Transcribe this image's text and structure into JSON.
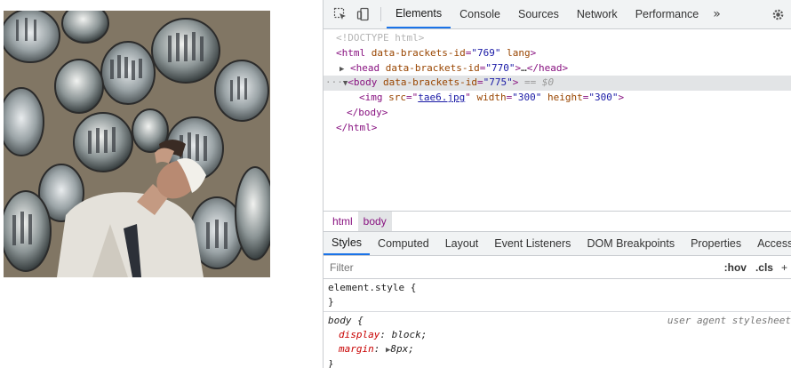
{
  "page": {
    "image_alt": "Photo of a young man in a white jacket and cap looking upward, surrounded by round convex mirrors reflecting a group of people in an alley"
  },
  "devtools": {
    "tabs": [
      "Elements",
      "Console",
      "Sources",
      "Network",
      "Performance"
    ],
    "more_tabs": "»",
    "dom": {
      "doctype": "<!DOCTYPE html>",
      "html_open_tag": "html",
      "html_attr": "data-brackets-id",
      "html_attr_val": "\"769\"",
      "html_attr2": "lang",
      "head_tag": "head",
      "head_attr": "data-brackets-id",
      "head_attr_val": "\"770\"",
      "head_ellipsis": "…",
      "head_close": "</head>",
      "body_tag": "body",
      "body_attr": "data-brackets-id",
      "body_attr_val": "\"775\"",
      "body_eq": "== $0",
      "img_tag": "img",
      "img_src_attr": "src",
      "img_src_val": "tae6.jpg",
      "img_width_attr": "width",
      "img_width_val": "\"300\"",
      "img_height_attr": "height",
      "img_height_val": "\"300\"",
      "body_close": "</body>",
      "html_close": "</html>"
    },
    "breadcrumbs": [
      "html",
      "body"
    ],
    "sub_tabs": [
      "Styles",
      "Computed",
      "Layout",
      "Event Listeners",
      "DOM Breakpoints",
      "Properties",
      "Accessibility"
    ],
    "filter_placeholder": "Filter",
    "hov_label": ":hov",
    "cls_label": ".cls",
    "plus_label": "+",
    "styles": {
      "element_style_selector": "element.style {",
      "element_style_close": "}",
      "body_selector": "body {",
      "ua_label": "user agent stylesheet",
      "display_prop": "display",
      "display_val": "block;",
      "margin_prop": "margin",
      "margin_val": "8px;",
      "body_close": "}"
    }
  }
}
